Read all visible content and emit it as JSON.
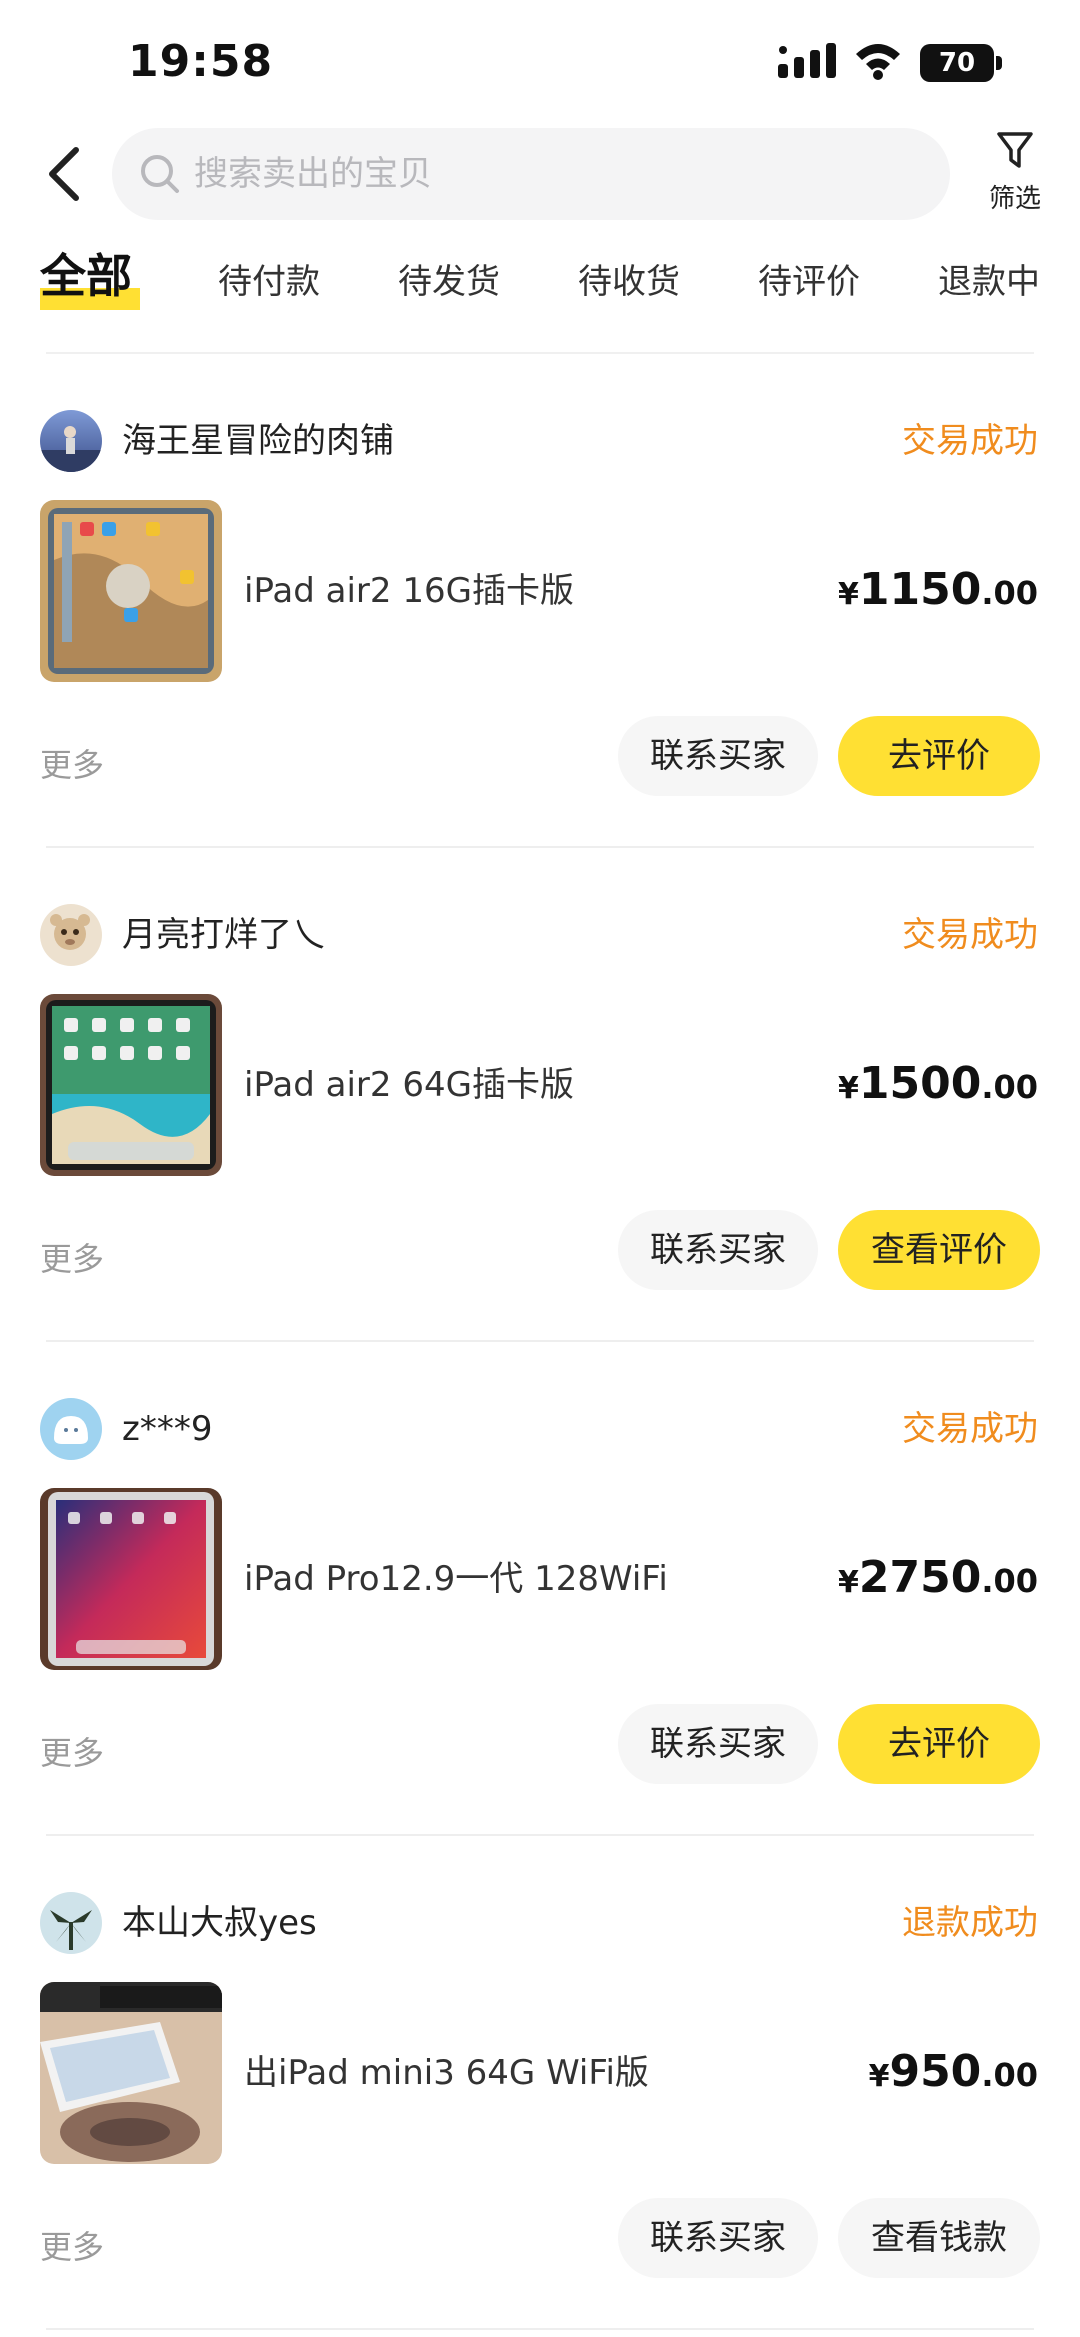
{
  "status_bar": {
    "time": "19:58",
    "battery": "70"
  },
  "header": {
    "search_placeholder": "搜索卖出的宝贝",
    "filter_label": "筛选"
  },
  "tabs": [
    "全部",
    "待付款",
    "待发货",
    "待收货",
    "待评价",
    "退款中"
  ],
  "colors": {
    "accent_yellow": "#ffe033",
    "status_orange": "#f08c1e",
    "muted_text": "#9a9a9a"
  },
  "orders": [
    {
      "buyer": "海王星冒险的肉铺",
      "status": "交易成功",
      "title": "iPad air2 16G插卡版",
      "currency": "¥",
      "price_int": "1150",
      "price_dec": ".00",
      "more": "更多",
      "btn1": "联系买家",
      "btn2": "去评价"
    },
    {
      "buyer": "月亮打烊了乀",
      "status": "交易成功",
      "title": "iPad air2 64G插卡版",
      "currency": "¥",
      "price_int": "1500",
      "price_dec": ".00",
      "more": "更多",
      "btn1": "联系买家",
      "btn2": "查看评价"
    },
    {
      "buyer": "z***9",
      "status": "交易成功",
      "title": "iPad Pro12.9一代 128WiFi",
      "currency": "¥",
      "price_int": "2750",
      "price_dec": ".00",
      "more": "更多",
      "btn1": "联系买家",
      "btn2": "去评价"
    },
    {
      "buyer": "本山大叔yes",
      "status": "退款成功",
      "title": "出iPad mini3 64G WiFi版",
      "currency": "¥",
      "price_int": "950",
      "price_dec": ".00",
      "more": "更多",
      "btn1": "联系买家",
      "btn2": "查看钱款"
    }
  ]
}
